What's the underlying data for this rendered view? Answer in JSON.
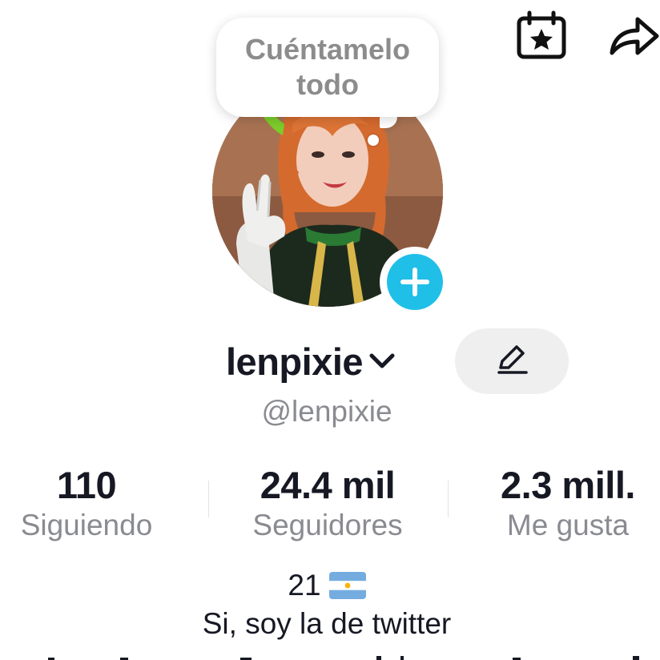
{
  "header": {
    "icons": [
      "calendar-star-icon",
      "share-icon"
    ]
  },
  "bubble": {
    "text_line_1": "Cuéntamelo",
    "text_line_2": "todo"
  },
  "profile": {
    "username": "lenpixie",
    "handle": "@lenpixie",
    "add_story_icon": "plus-icon",
    "edit_icon": "pencil-icon"
  },
  "stats": [
    {
      "value": "110",
      "label": "Siguiendo"
    },
    {
      "value": "24.4 mil",
      "label": "Seguidores"
    },
    {
      "value": "2.3 mill.",
      "label": "Me gusta"
    }
  ],
  "bio": {
    "line_1": "21",
    "flag": "argentina-flag",
    "line_2": "Si, soy la de twitter"
  },
  "colors": {
    "accent": "#20bfe8",
    "primary_text": "#161823",
    "secondary_text": "#8a8b91",
    "edit_button_bg": "#efefef"
  }
}
